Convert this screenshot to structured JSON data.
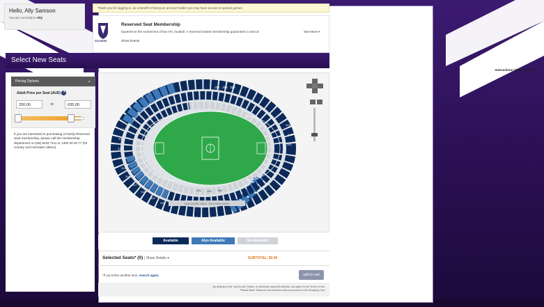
{
  "header": {
    "greeting": "Hello, Ally Samson",
    "currently_in": "You are currently in",
    "currently_in_value": "Ally",
    "notice": "Thank you for logging in, as a benefit of being an account holder you may have access to special games."
  },
  "promo": {
    "title": "Reserved Seat Membership",
    "description": "Experience the excitement of live AFL football. A reserved seated membership guarantees a seat at",
    "see_more": "See More",
    "show_events": "Show Events",
    "logo_text": "DOCKERS"
  },
  "section": {
    "title": "Select New Seats",
    "links": "Instructions | Map Disclaimer"
  },
  "pricing": {
    "header": "Pricing Options",
    "label": "Adult Price per Seat (AUD)",
    "min": "330.00",
    "to": "to",
    "max": "635.00",
    "slider_low": 0.0,
    "slider_high": 0.82,
    "note": "If you are interested in purchasing a Family Reserved Seat membership, please call the membership department on (08) 9433 7111 or 1300 00 20 77 (for country and interstate callers)."
  },
  "legend": {
    "available": "Available",
    "also_available": "Also Available",
    "not_available": "Not Available"
  },
  "selected": {
    "label": "Selected Seats* (0)",
    "show_details": "Show Details",
    "subtotal": "SUBTOTAL: $0.00"
  },
  "search": {
    "text": "*If you'd like another item,",
    "link": "search again."
  },
  "add_to_cart": "add to cart",
  "fine_print": {
    "line1": "By clicking on the \"add to cart\" button, or otherwise using this website, you agree to the Terms of Use.",
    "line2": "*Please Note: Seats are not reserved until you proceed to the Shopping Cart."
  },
  "stadium": {
    "labels_top": [
      "301",
      "302",
      "303"
    ],
    "labels_left": [
      "311",
      "312",
      "313",
      "314",
      "315",
      "316",
      "317",
      "318",
      "319",
      "320"
    ],
    "labels_right": [
      "341",
      "342",
      "343"
    ],
    "labels_bottom": [
      "131",
      "132",
      "133"
    ],
    "bottom_stand": "MAIN ROUND STAND · SOUTHERN STAND"
  },
  "colors": {
    "available": "#0b2a5a",
    "also_available": "#3f79b7",
    "not_available": "#cfd3d8",
    "field": "#2fa84a",
    "background": "#2a0f52",
    "accent": "#e07b1a"
  }
}
